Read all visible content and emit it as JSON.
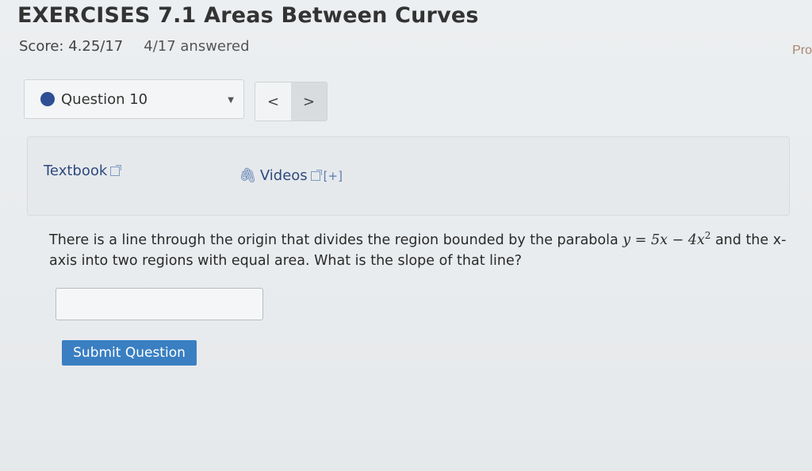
{
  "header": {
    "title": "EXERCISES 7.1 Areas Between Curves",
    "score": "Score: 4.25/17",
    "answered": "4/17 answered",
    "pro_link": "Pro"
  },
  "question_nav": {
    "selected": "Question 10",
    "prev": "<",
    "next": ">"
  },
  "resources": {
    "textbook": "Textbook",
    "videos": "Videos",
    "expand": "[+]"
  },
  "question": {
    "text_before": "There is a line through the origin that divides the region bounded by the parabola ",
    "math_y": "y",
    "math_eq": " = 5x − 4x",
    "math_exp": "2",
    "text_after": " and the x-axis into two regions with equal area. What is the slope of that line?"
  },
  "answer": {
    "placeholder": ""
  },
  "submit_label": "Submit Question",
  "colors": {
    "accent": "#3a7fc2",
    "dot": "#2e4f94",
    "link": "#2e4a7d"
  }
}
